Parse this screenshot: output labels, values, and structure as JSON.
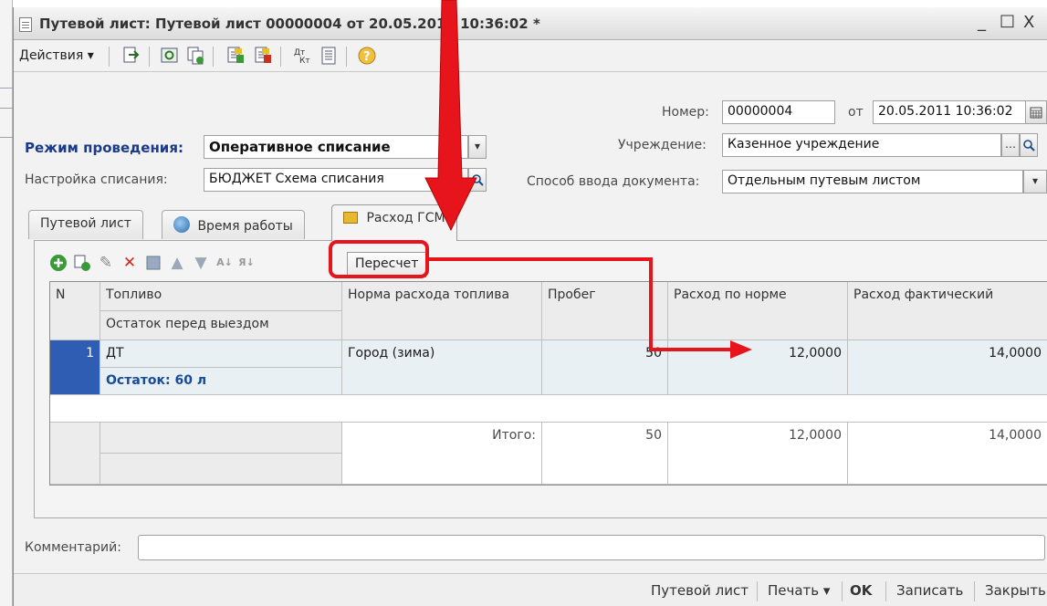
{
  "window": {
    "title": "Путевой лист: Путевой лист 00000004 от 20.05.2011 10:36:02 *",
    "minimize": "_",
    "maximize": "□",
    "close": "X"
  },
  "toolbar": {
    "actions_label": "Действия ▾"
  },
  "header": {
    "number_label": "Номер:",
    "number_value": "00000004",
    "from_label": "от",
    "date_value": "20.05.2011 10:36:02",
    "mode_label": "Режим проведения:",
    "mode_value": "Оперативное списание",
    "institution_label": "Учреждение:",
    "institution_value": "Казенное учреждение",
    "writeoff_label": "Настройка списания:",
    "writeoff_value": "БЮДЖЕТ Схема списания",
    "input_method_label": "Способ ввода документа:",
    "input_method_value": "Отдельным путевым листом"
  },
  "tabs": [
    {
      "label": "Путевой лист"
    },
    {
      "label": "Время работы"
    },
    {
      "label": "Расход ГСМ"
    }
  ],
  "panel": {
    "recalc_label": "Пересчет"
  },
  "table": {
    "columns": {
      "n": "N",
      "fuel": "Топливо",
      "remain_before": "Остаток перед выездом",
      "norm": "Норма расхода топлива",
      "mileage": "Пробег",
      "by_norm": "Расход по норме",
      "actual": "Расход фактический"
    },
    "rows": [
      {
        "n": "1",
        "fuel": "ДТ",
        "remain": "Остаток: 60 л",
        "norm": "Город (зима)",
        "mileage": "50",
        "by_norm": "12,0000",
        "actual": "14,0000"
      }
    ],
    "totals": {
      "label": "Итого:",
      "mileage": "50",
      "by_norm": "12,0000",
      "actual": "14,0000"
    }
  },
  "comment": {
    "label": "Комментарий:",
    "value": ""
  },
  "bottom": {
    "waybill": "Путевой лист",
    "print": "Печать ▾",
    "ok": "OK",
    "save": "Записать",
    "close": "Закрыть"
  },
  "colors": {
    "annotation": "#e8141c",
    "selected_row_marker": "#2e5db3",
    "mode_label": "#1a3a8a"
  }
}
